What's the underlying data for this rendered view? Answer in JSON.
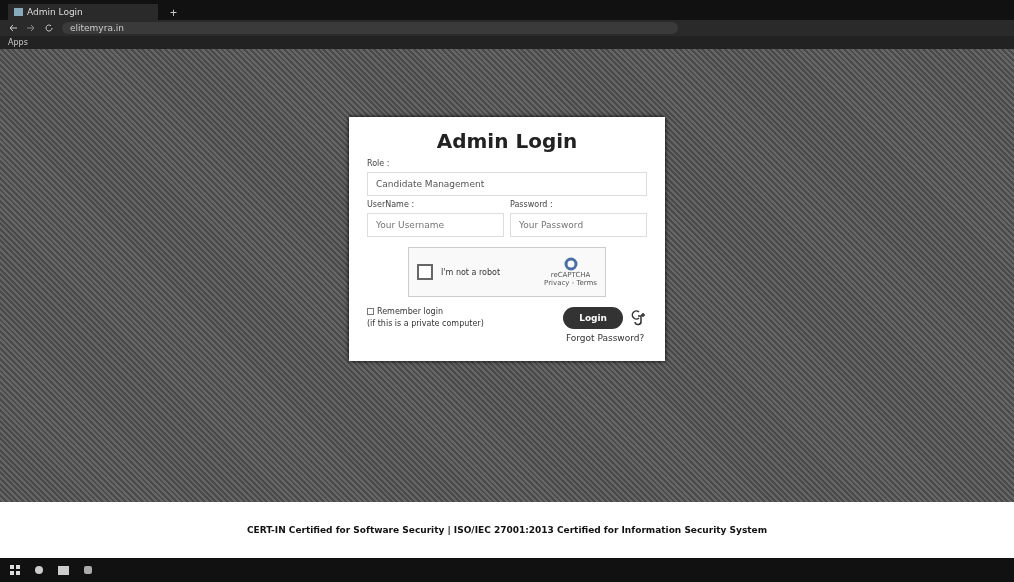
{
  "browser": {
    "tab_title": "Admin Login",
    "new_tab": "+",
    "address": "elitemyra.in",
    "bookmarks": [
      "Apps"
    ]
  },
  "login": {
    "title": "Admin Login",
    "role_label": "Role :",
    "role_value": "Candidate Management",
    "username_label": "UserName :",
    "username_placeholder": "Your Username",
    "password_label": "Password :",
    "password_placeholder": "Your Password",
    "captcha": {
      "label": "I'm not a robot",
      "brand": "reCAPTCHA",
      "links": "Privacy - Terms",
      "checked": false
    },
    "remember": {
      "label": "Remember login",
      "note": "(if this is a private computer)",
      "checked": false
    },
    "login_button": "Login",
    "forgot_link": "Forgot Password?"
  },
  "footer": "CERT-IN  Certified for Software Security | ISO/IEC 27001:2013 Certified for Information Security System"
}
